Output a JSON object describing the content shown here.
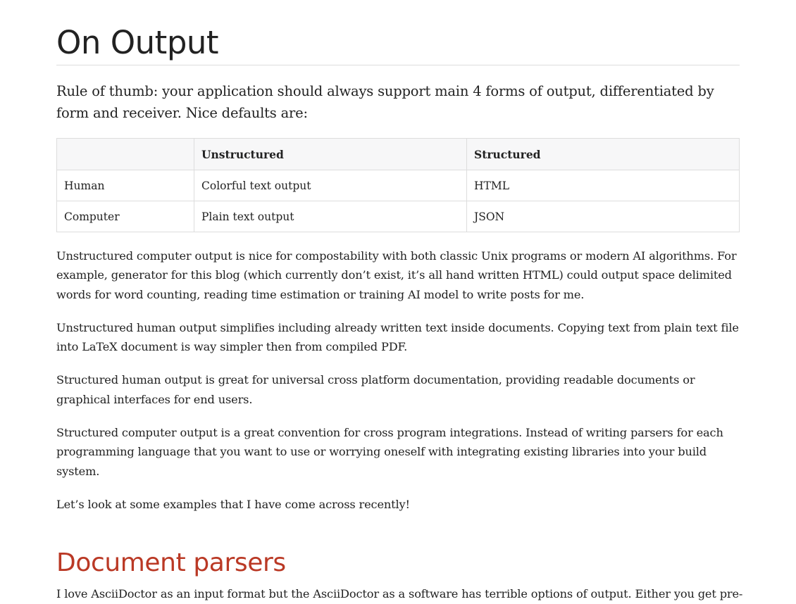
{
  "heading": "On Output",
  "lead": "Rule of thumb: your application should always support main 4 forms of output, differentiated by form and receiver. Nice defaults are:",
  "table": {
    "headers": [
      "",
      "Unstructured",
      "Structured"
    ],
    "rows": [
      [
        "Human",
        "Colorful text output",
        "HTML"
      ],
      [
        "Computer",
        "Plain text output",
        "JSON"
      ]
    ]
  },
  "paragraphs": [
    "Unstructured computer output is nice for compostability with both classic Unix programs or modern AI algorithms. For example, generator for this blog (which currently don’t exist, it’s all hand written HTML) could output space delimited words for word counting, reading time estimation or training AI model to write posts for me.",
    "Unstructured human output simplifies including already written text inside documents. Copying text from plain text file into LaTeX document is way simpler then from compiled PDF.",
    "Structured human output is great for universal cross platform documentation, providing readable documents or graphical interfaces for end users.",
    "Structured computer output is a great convention for cross program integrations. Instead of writing parsers for each programming language that you want to use or worrying oneself with integrating existing libraries into your build system.",
    "Let’s look at some examples that I have come across recently!"
  ],
  "section": {
    "heading": "Document parsers",
    "first_paragraph_visible": "I love AsciiDoctor as an input format but the AsciiDoctor as a software has terrible options of output. Either you get pre-"
  },
  "colors": {
    "text": "#222222",
    "section_heading": "#ba3925",
    "rule": "#dddddd",
    "table_header_bg": "#f7f7f8"
  }
}
